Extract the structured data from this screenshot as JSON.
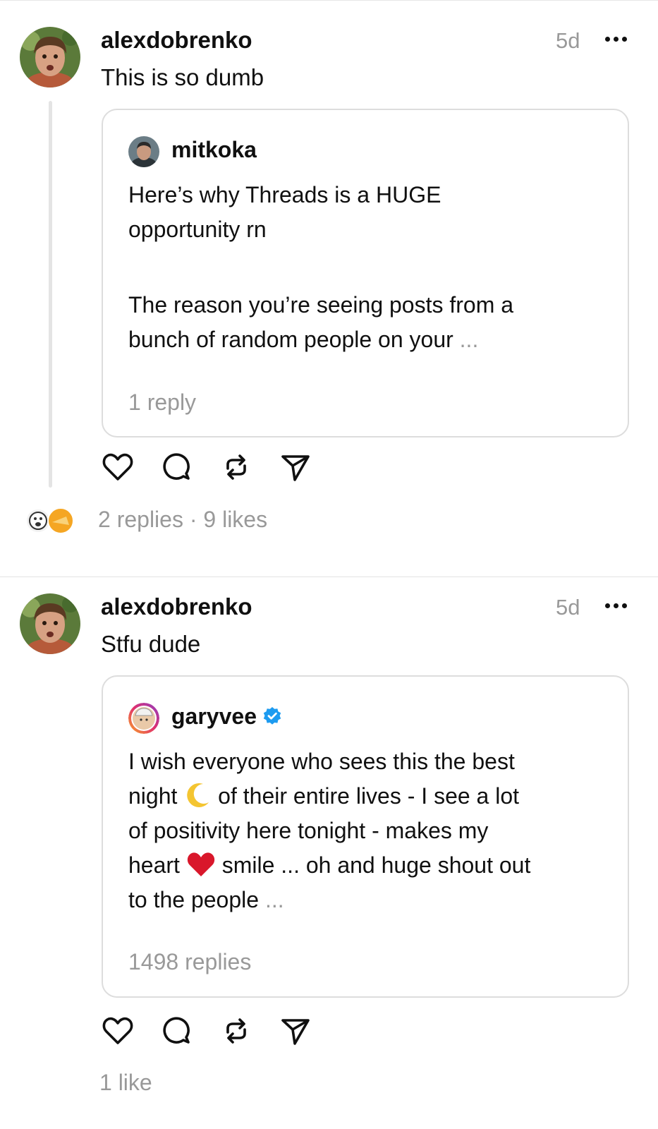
{
  "posts": [
    {
      "username": "alexdobrenko",
      "time": "5d",
      "text": "This is so dumb",
      "quote": {
        "username": "mitkoka",
        "verified": false,
        "lines": [
          "Here’s why Threads is a HUGE",
          "opportunity rn",
          "",
          "The reason you’re seeing posts from a",
          "bunch of random people on your"
        ],
        "ellipsis": "...",
        "replies": "1 reply"
      },
      "stats": "2 replies · 9 likes"
    },
    {
      "username": "alexdobrenko",
      "time": "5d",
      "text": "Stfu dude",
      "quote": {
        "username": "garyvee",
        "verified": true,
        "lines": [
          "I wish everyone who sees this the best",
          "night",
          "of their entire lives - I see a lot",
          "of positivity here tonight - makes my",
          "heart",
          "smile ... oh and huge shout out",
          "to the people"
        ],
        "ellipsis": "...",
        "replies": "1498 replies"
      },
      "stats": "1 like"
    }
  ],
  "icons": {
    "more": "more-dots-icon",
    "like": "heart-icon",
    "reply": "comment-bubble-icon",
    "repost": "repost-icon",
    "share": "send-icon",
    "verified": "verified-badge-icon",
    "moon": "crescent-moon-emoji",
    "heart_emoji": "red-heart-emoji"
  },
  "colors": {
    "text": "#101010",
    "muted": "#999999",
    "border": "#dddddd",
    "verified": "#1d9bf0",
    "heart_emoji": "#d9172b",
    "moon": "#f4c531"
  }
}
